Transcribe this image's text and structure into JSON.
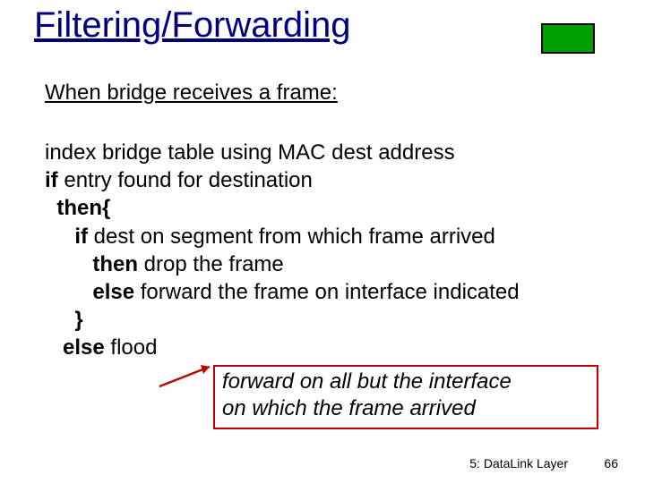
{
  "title": "Filtering/Forwarding",
  "subtitle": "When bridge receives a frame:",
  "body": {
    "l1": "index bridge table using MAC dest address",
    "l2_kw": "if",
    "l2_rest": " entry found for destination",
    "l3_kw": "then{",
    "l4_kw": "if",
    "l4_rest": " dest on segment from which frame arrived",
    "l5_kw": "then",
    "l5_rest": " drop the frame",
    "l6_kw": "else",
    "l6_rest": " forward the frame on interface indicated",
    "l7_kw": "}",
    "l8_kw": "else",
    "l8_rest": " flood"
  },
  "callout": {
    "line1": "forward on all but the interface",
    "line2": "on which the frame arrived"
  },
  "footer": {
    "section": "5: DataLink Layer",
    "page": "66"
  }
}
